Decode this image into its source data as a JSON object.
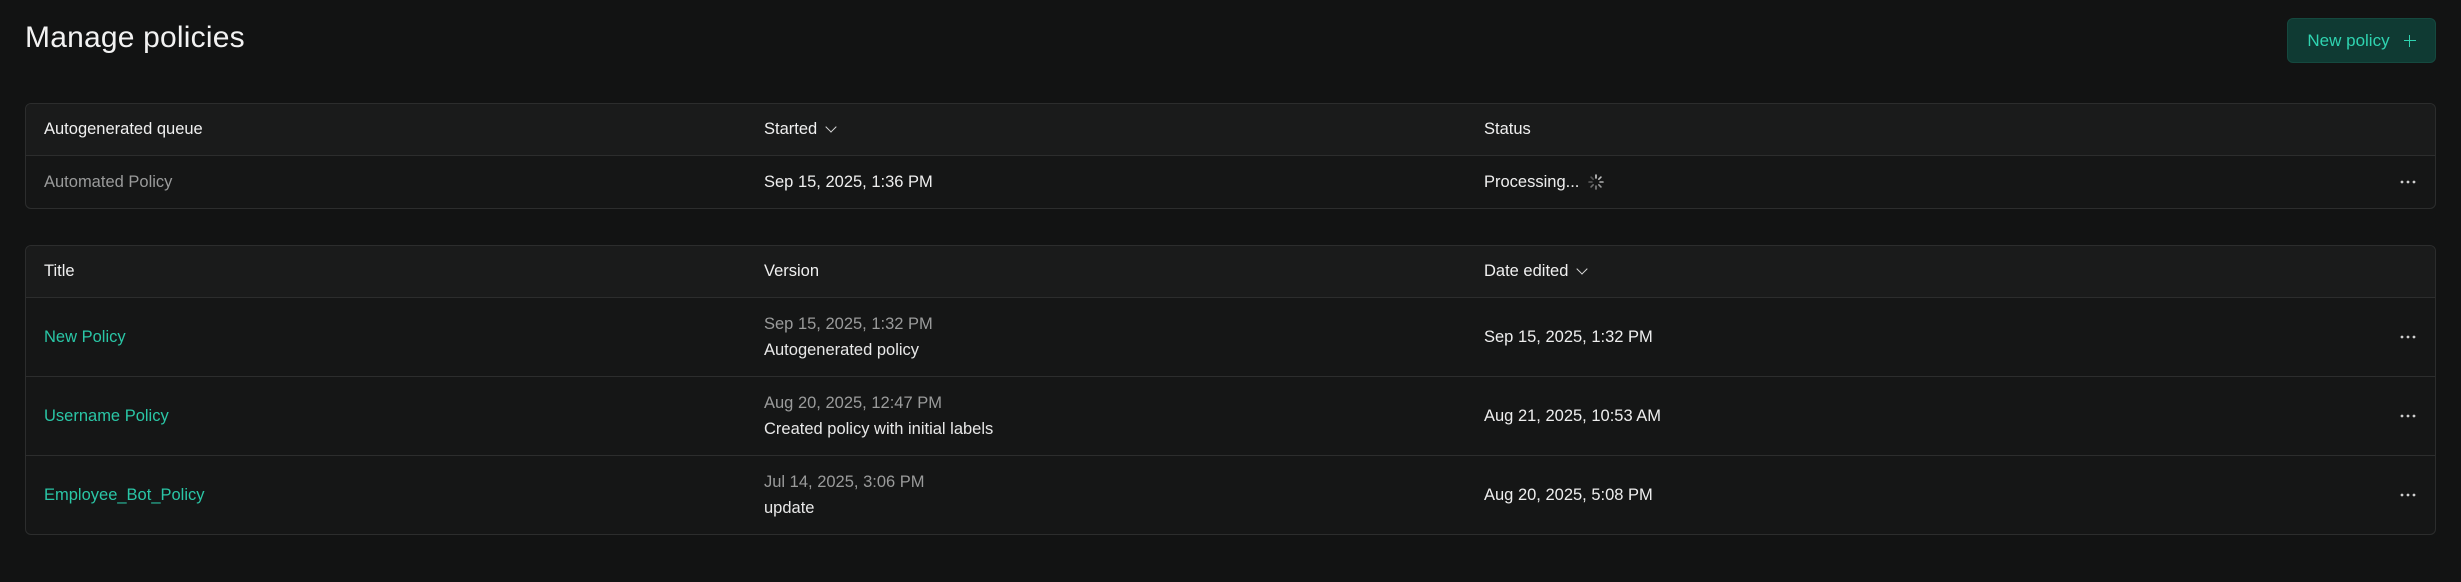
{
  "page": {
    "title": "Manage policies",
    "new_policy_label": "New policy"
  },
  "queue_table": {
    "headers": {
      "col1": "Autogenerated queue",
      "col2": "Started",
      "col3": "Status"
    },
    "rows": [
      {
        "name": "Automated Policy",
        "started": "Sep 15, 2025, 1:36 PM",
        "status": "Processing..."
      }
    ]
  },
  "policies_table": {
    "headers": {
      "col1": "Title",
      "col2": "Version",
      "col3": "Date edited"
    },
    "rows": [
      {
        "title": "New Policy",
        "version_date": "Sep 15, 2025, 1:32 PM",
        "version_desc": "Autogenerated policy",
        "date_edited": "Sep 15, 2025, 1:32 PM"
      },
      {
        "title": "Username Policy",
        "version_date": "Aug 20, 2025, 12:47 PM",
        "version_desc": "Created policy with initial labels",
        "date_edited": "Aug 21, 2025, 10:53 AM"
      },
      {
        "title": "Employee_Bot_Policy",
        "version_date": "Jul 14, 2025, 3:06 PM",
        "version_desc": "update",
        "date_edited": "Aug 20, 2025, 5:08 PM"
      }
    ]
  },
  "icons": {
    "new_policy": "plus-icon",
    "sort": "chevron-down-icon",
    "loading": "spinner-icon",
    "row_menu": "more-horizontal-icon"
  },
  "colors": {
    "background": "#121313",
    "accent": "#2ac6a6",
    "button_bg": "#0f3a33"
  }
}
